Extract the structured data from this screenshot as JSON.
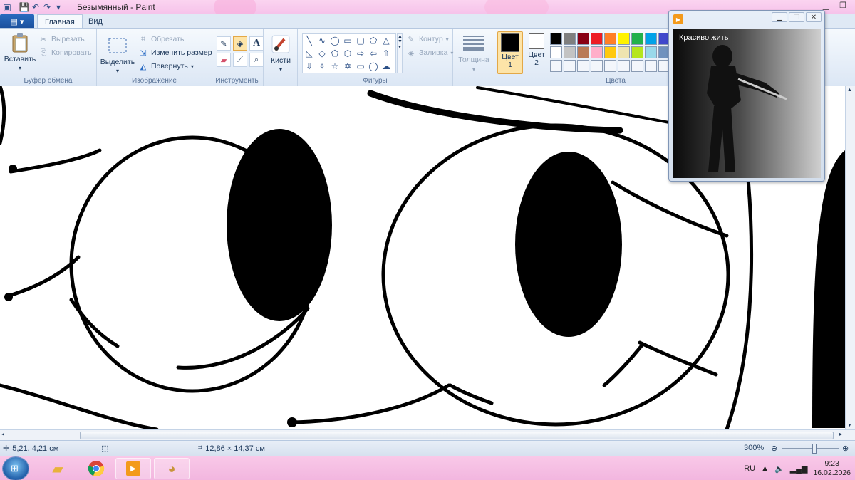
{
  "window": {
    "title": "Безымянный - Paint"
  },
  "ribbon": {
    "file_menu_icon": "paint-menu-icon",
    "tabs": [
      {
        "label": "Главная",
        "active": true
      },
      {
        "label": "Вид",
        "active": false
      }
    ],
    "clipboard": {
      "label": "Буфер обмена",
      "paste": "Вставить",
      "cut": "Вырезать",
      "copy": "Копировать"
    },
    "image": {
      "label": "Изображение",
      "select": "Выделить",
      "crop": "Обрезать",
      "resize": "Изменить размер",
      "rotate": "Повернуть"
    },
    "tools": {
      "label": "Инструменты"
    },
    "brushes": {
      "label": "Кисти"
    },
    "shapes": {
      "label": "Фигуры",
      "outline": "Контур",
      "fill": "Заливка"
    },
    "size": {
      "label": "Толщина"
    },
    "colors": {
      "label": "Цвета",
      "color1": "Цвет 1",
      "color2": "Цвет 2",
      "color1_value": "#000000",
      "color2_value": "#ffffff",
      "palette": [
        "#000000",
        "#7f7f7f",
        "#880015",
        "#ed1c24",
        "#ff7f27",
        "#fff200",
        "#22b14c",
        "#00a2e8",
        "#3f48cc",
        "#ffffff",
        "#c3c3c3",
        "#b97a57",
        "#ffaec9",
        "#ffc90e",
        "#efe4b0",
        "#b5e61d",
        "#99d9ea",
        "#7092be",
        "#f3f6fb",
        "#f3f6fb",
        "#f3f6fb",
        "#f3f6fb",
        "#f3f6fb",
        "#f3f6fb",
        "#f3f6fb",
        "#f3f6fb",
        "#f3f6fb"
      ]
    }
  },
  "status": {
    "cursor_pos": "5,21, 4,21 см",
    "image_size": "12,86 × 14,37 см",
    "zoom": "300%"
  },
  "player": {
    "caption": "Красиво жить"
  },
  "taskbar": {
    "lang": "RU",
    "time": "9:23",
    "date": "16.02.2026"
  }
}
